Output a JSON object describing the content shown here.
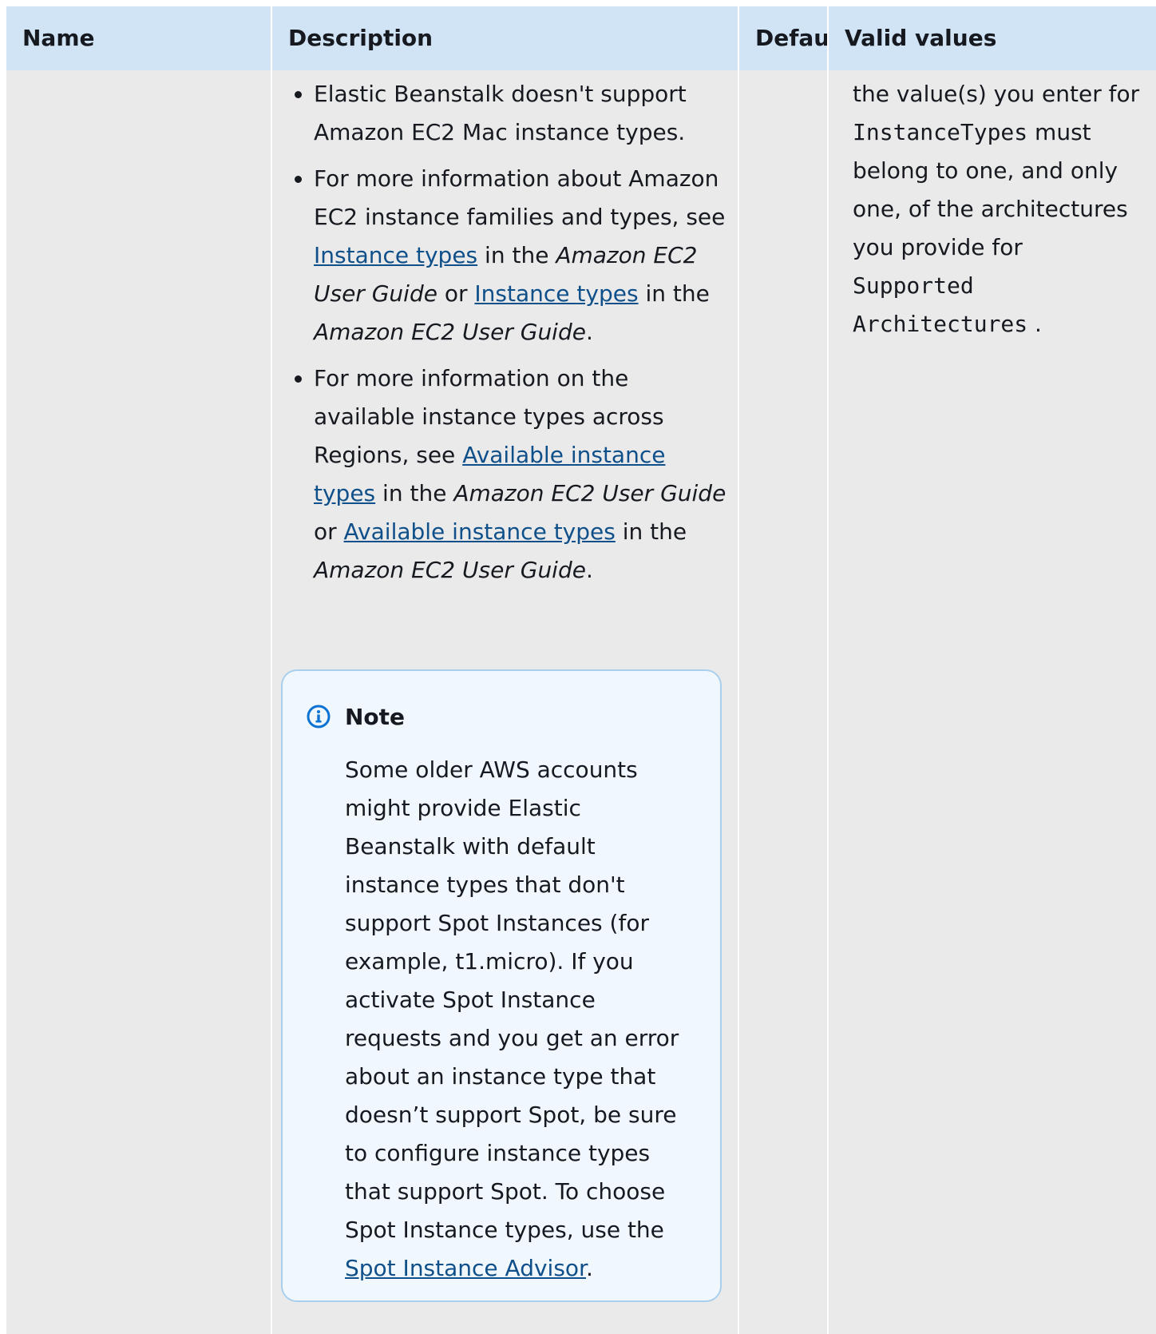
{
  "headers": {
    "name": "Name",
    "description": "Description",
    "default": "Default",
    "valid_values": "Valid values"
  },
  "description": {
    "b1": "Elastic Beanstalk doesn't support Amazon EC2 Mac instance types.",
    "b2_pre": "For more information about Amazon EC2 instance families and types, see ",
    "b2_link1": "Instance types",
    "b2_mid1": " in the ",
    "b2_em1": "Amazon EC2 User Guide",
    "b2_mid2": " or ",
    "b2_link2": "Instance types",
    "b2_mid3": " in the ",
    "b2_em2": "Amazon EC2 User Guide",
    "b2_end": ".",
    "b3_pre": "For more information on the available instance types across Regions, see ",
    "b3_link1": "Available instance types",
    "b3_mid1": " in the ",
    "b3_em1": "Amazon EC2 User Guide",
    "b3_mid2": " or ",
    "b3_link2": "Available instance types",
    "b3_mid3": " in the ",
    "b3_em2": "Amazon EC2 User Guide",
    "b3_end": "."
  },
  "note": {
    "icon": "info-icon",
    "title": "Note",
    "body": "Some older AWS accounts might provide Elastic Beanstalk with default instance types that don't support Spot Instances (for example, t1.micro). If you activate Spot Instance requests and you get an error about an instance type that doesn’t support Spot, be sure to configure instance types that support Spot. To choose Spot Instance types, use the ",
    "link": "Spot Instance Advisor",
    "end": "."
  },
  "valid_values": {
    "t1": "the value(s) you enter for ",
    "code1": "InstanceTypes",
    "t2": " must belong to one, and only one, of the architectures you provide for ",
    "code2": "Supported Architectures",
    "t3": " ."
  },
  "colors": {
    "header_bg": "#d1e4f5",
    "cell_bg": "#eaeaea",
    "link": "#0f4f8a",
    "note_bg": "#f1f8fd",
    "note_border": "#a8cfee",
    "info_icon": "#0972d3"
  }
}
